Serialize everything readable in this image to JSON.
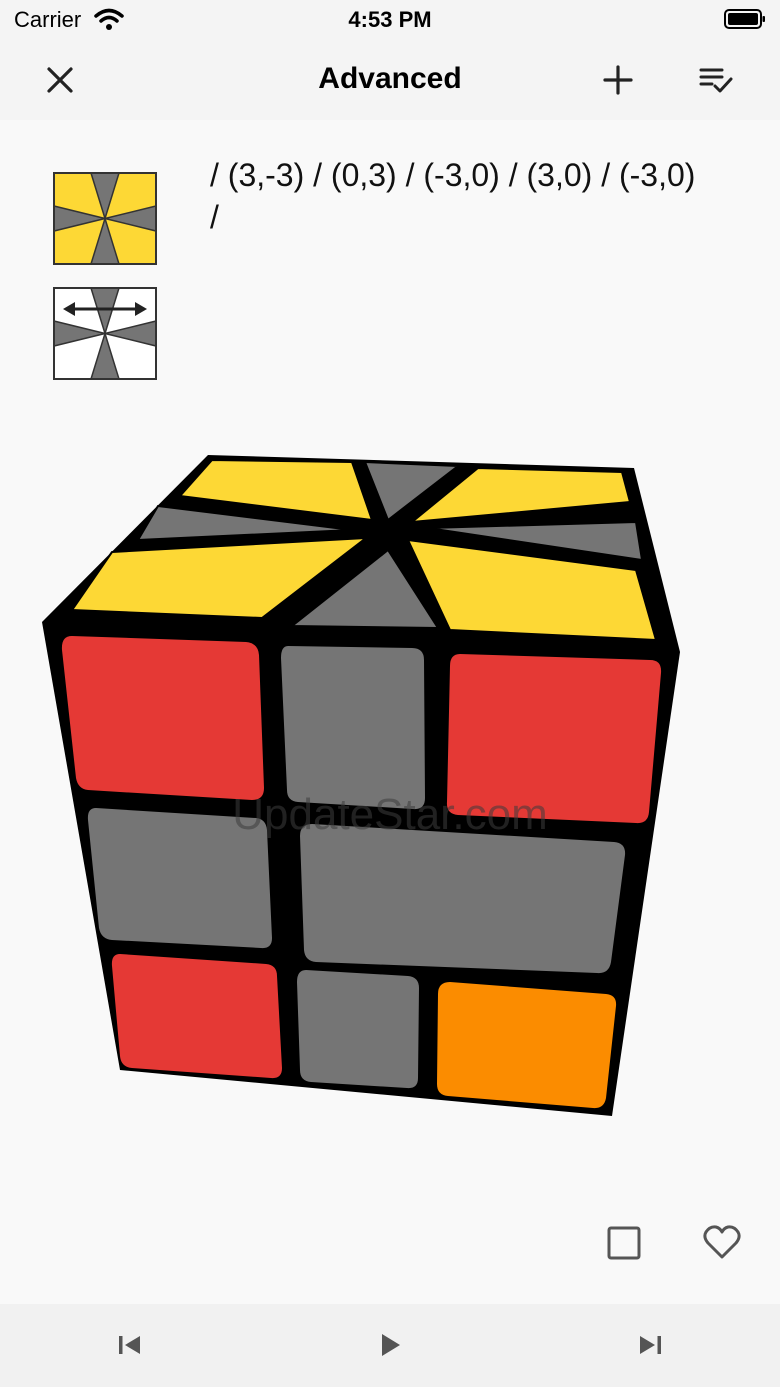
{
  "status": {
    "carrier": "Carrier",
    "time": "4:53 PM"
  },
  "nav": {
    "title": "Advanced",
    "left_icon": "close-icon",
    "right_icons": [
      "add-icon",
      "checklist-icon"
    ]
  },
  "algorithm": {
    "text": "/ (3,-3) / (0,3) / (-3,0) / (3,0) / (-3,0) /"
  },
  "watermark": "UpdateStar.com",
  "colors": {
    "yellow": "#fdd835",
    "gray": "#757575",
    "red": "#e53935",
    "orange": "#fb8c00",
    "white": "#ffffff",
    "black": "#000000",
    "icon": "#555555"
  },
  "bottom_actions": [
    "square-icon",
    "heart-icon"
  ],
  "toolbar": [
    "skip-previous-icon",
    "play-icon",
    "skip-next-icon"
  ]
}
